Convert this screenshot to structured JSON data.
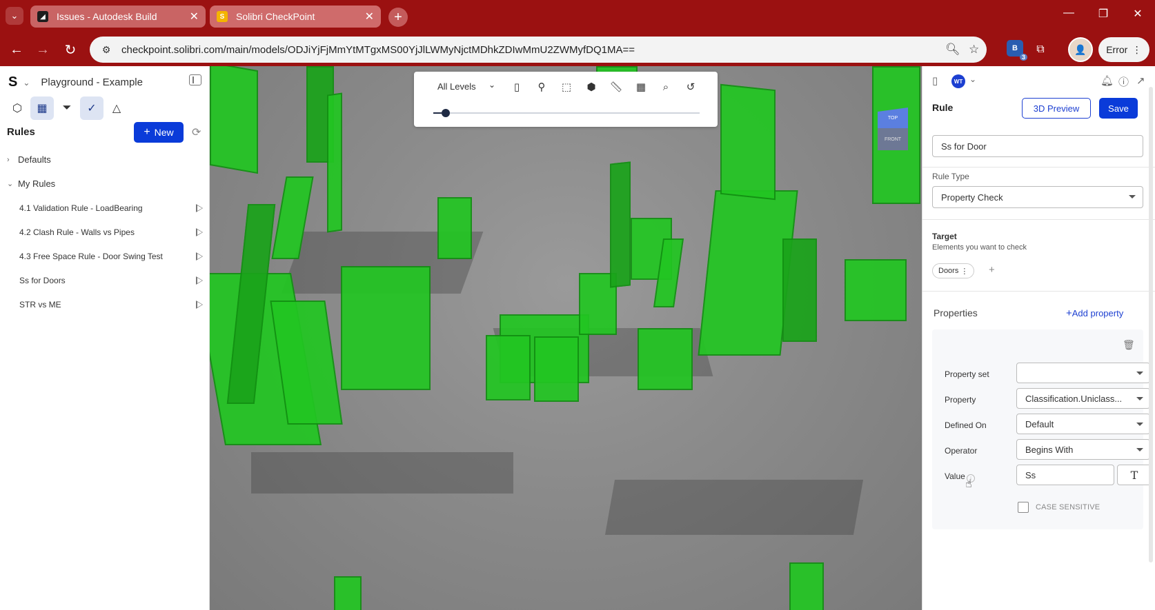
{
  "browser": {
    "tabs": [
      {
        "title": "Issues - Autodesk Build",
        "favicon": "autodesk-icon",
        "active": false
      },
      {
        "title": "Solibri CheckPoint",
        "favicon": "solibri-icon",
        "active": true
      }
    ],
    "url": "checkpoint.solibri.com/main/models/ODJiYjFjMmYtMTgxMS00YjJlLWMyNjctMDhkZDIwMmU2ZWMyfDQ1MA==",
    "extension_badge": "3",
    "profile_button": "Error"
  },
  "left_panel": {
    "logo": "S",
    "project": "Playground - Example",
    "rules_title": "Rules",
    "new_label": "New",
    "groups": [
      {
        "label": "Defaults",
        "expanded": false
      },
      {
        "label": "My Rules",
        "expanded": true
      }
    ],
    "rules": [
      "4.1 Validation Rule - LoadBearing",
      "4.2 Clash Rule - Walls vs Pipes",
      "4.3 Free Space Rule - Door Swing Test",
      "Ss for Doors",
      "STR vs ME"
    ]
  },
  "viewport": {
    "level_select": "All Levels",
    "viewcube_top": "TOP",
    "viewcube_front": "FRONT",
    "level_slider": 0.03,
    "highlight_color": "#22c622"
  },
  "right_panel": {
    "user_initials": "WT",
    "section_title": "Rule",
    "preview_label": "3D Preview",
    "save_label": "Save",
    "rule_name": "Ss for Door",
    "rule_type_label": "Rule Type",
    "rule_type": "Property Check",
    "target_title": "Target",
    "target_subtitle": "Elements you want to check",
    "target_chip": "Doors",
    "properties_title": "Properties",
    "add_property_label": "Add property",
    "property_set_label": "Property set",
    "property_set_value": "",
    "property_label": "Property",
    "property_value": "Classification.Uniclass...",
    "defined_on_label": "Defined On",
    "defined_on_value": "Default",
    "operator_label": "Operator",
    "operator_value": "Begins With",
    "value_label": "Value",
    "value_value": "Ss",
    "case_sensitive_label": "CASE SENSITIVE",
    "case_sensitive_checked": false,
    "accent_color": "#0a3bd9"
  }
}
